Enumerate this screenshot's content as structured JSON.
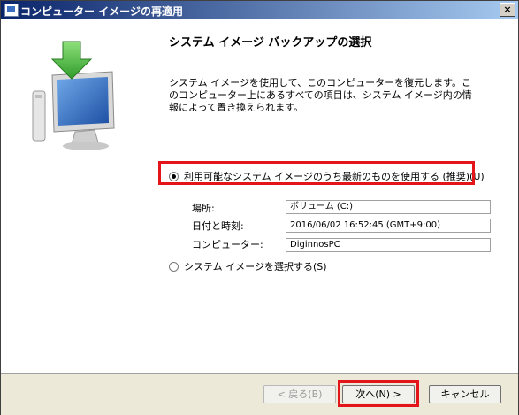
{
  "window": {
    "title": "コンピューター イメージの再適用",
    "close_label": "×"
  },
  "page": {
    "title": "システム イメージ バックアップの選択",
    "description": "システム イメージを使用して、このコンピューターを復元します。このコンピューター上にあるすべての項目は、システム イメージ内の情報によって置き換えられます。"
  },
  "options": {
    "latest_label": "利用可能なシステム イメージのうち最新のものを使用する (推奨)(U)",
    "select_label": "システム イメージを選択する(S)"
  },
  "details": {
    "location_label": "場所:",
    "location_value": "ボリューム (C:)",
    "datetime_label": "日付と時刻:",
    "datetime_value": "2016/06/02 16:52:45 (GMT+9:00)",
    "computer_label": "コンピューター:",
    "computer_value": "DiginnosPC"
  },
  "buttons": {
    "back": "< 戻る(B)",
    "next": "次へ(N) >",
    "cancel": "キャンセル"
  },
  "colors": {
    "highlight": "#e3141a",
    "titlebar_start": "#0a246a",
    "titlebar_end": "#a6caf0"
  }
}
